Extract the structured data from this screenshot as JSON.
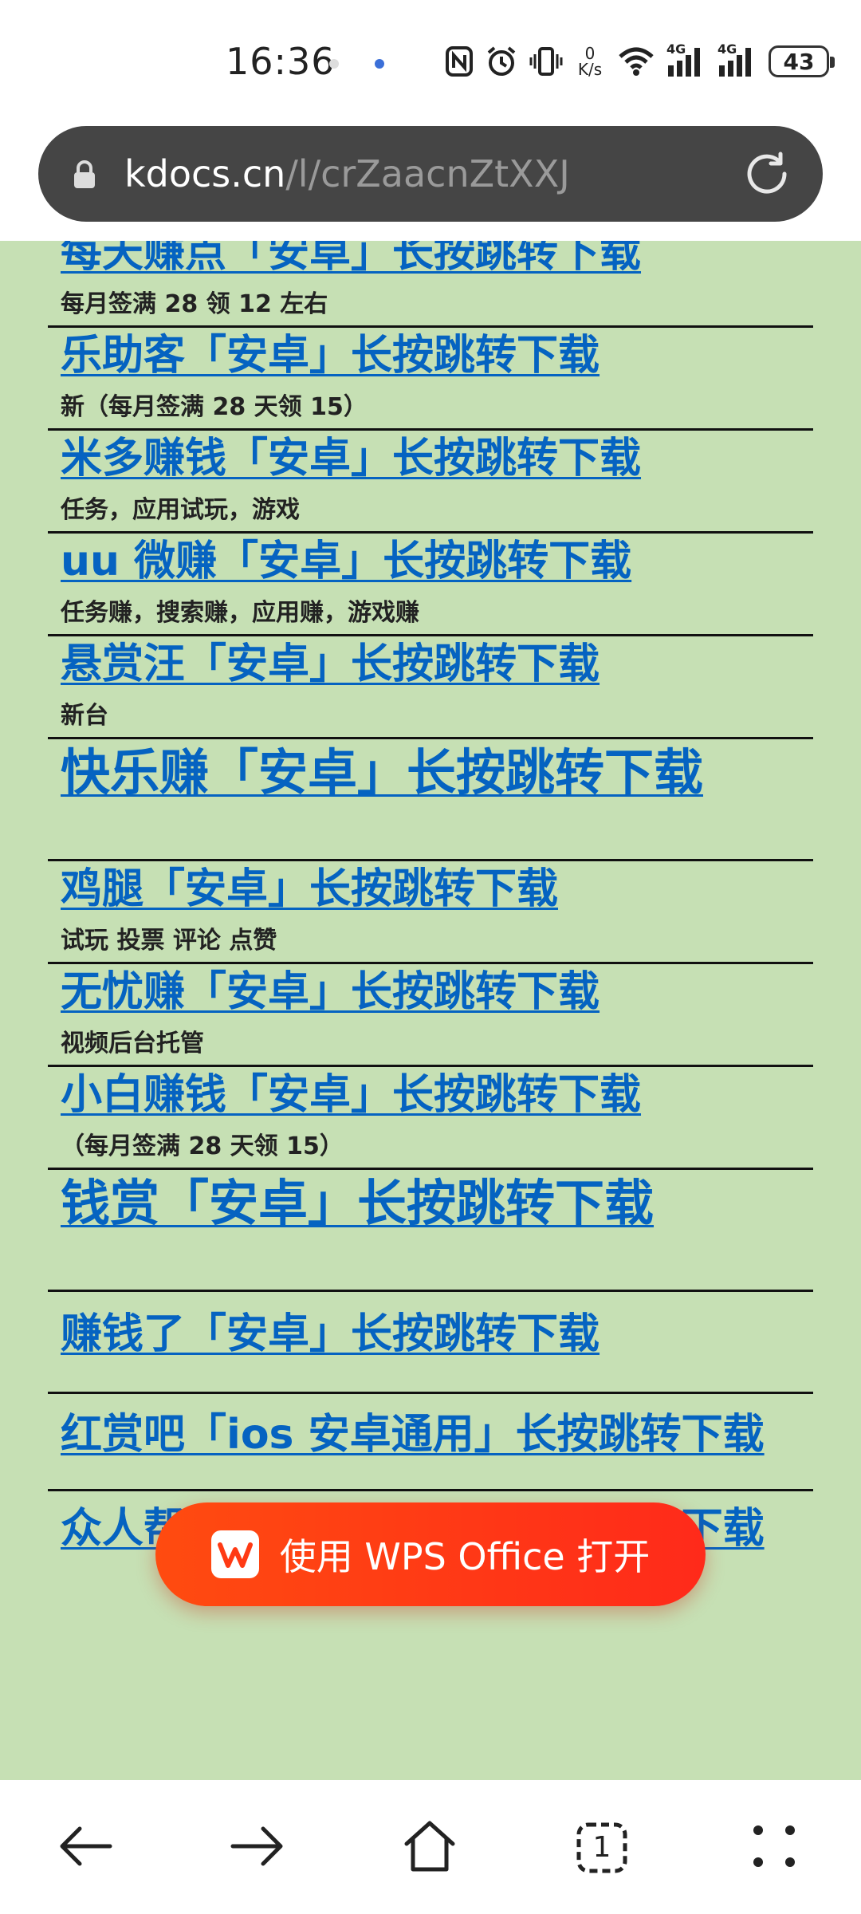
{
  "status_bar": {
    "time": "16:36",
    "net_speed_value": "0",
    "net_speed_unit": "K/s",
    "signal_1": "4G",
    "signal_2": "4G",
    "battery": "43"
  },
  "address_bar": {
    "host": "kdocs.cn",
    "path": "/l/crZaacnZtXXJ"
  },
  "entries": [
    {
      "title": "每天赚点「安卓」长按跳转下载",
      "desc": "每月签满 28 领 12 左右"
    },
    {
      "title": "乐助客「安卓」长按跳转下载",
      "desc": "新（每月签满 28 天领 15）"
    },
    {
      "title": "米多赚钱「安卓」长按跳转下载",
      "desc": "任务，应用试玩，游戏"
    },
    {
      "title": "uu 微赚「安卓」长按跳转下载",
      "desc": "任务赚，搜索赚，应用赚，游戏赚"
    },
    {
      "title": "悬赏汪「安卓」长按跳转下载",
      "desc": "新台"
    },
    {
      "title": "快乐赚「安卓」长按跳转下载",
      "desc": ""
    },
    {
      "title": "鸡腿「安卓」长按跳转下载",
      "desc": "试玩  投票  评论  点赞"
    },
    {
      "title": "无忧赚「安卓」长按跳转下载",
      "desc": "视频后台托管"
    },
    {
      "title": "小白赚钱「安卓」长按跳转下载",
      "desc": "（每月签满 28 天领 15）"
    },
    {
      "title": "钱赏「安卓」长按跳转下载",
      "desc": ""
    },
    {
      "title": "赚钱了「安卓」长按跳转下载",
      "desc": ""
    },
    {
      "title": "红赏吧「ios 安卓通用」长按跳转下载",
      "desc": ""
    },
    {
      "title": "众人帮「ios 安卓通用」长按跳转下载",
      "desc": ""
    }
  ],
  "wps_button": {
    "label": "使用 WPS Office 打开"
  },
  "bottom_nav": {
    "tab_count": "1"
  },
  "colors": {
    "doc_background": "#c6e0b4",
    "link": "#0563c1",
    "wps_red": "#ff3a14",
    "address_bar": "#454545"
  },
  "icons": [
    "lock-icon",
    "reload-icon",
    "back-arrow-icon",
    "forward-arrow-icon",
    "home-icon",
    "tabs-icon",
    "menu-dots-icon",
    "wps-logo-icon",
    "nfc-icon",
    "alarm-icon",
    "vibrate-icon",
    "wifi-icon",
    "signal-icon",
    "battery-icon"
  ]
}
